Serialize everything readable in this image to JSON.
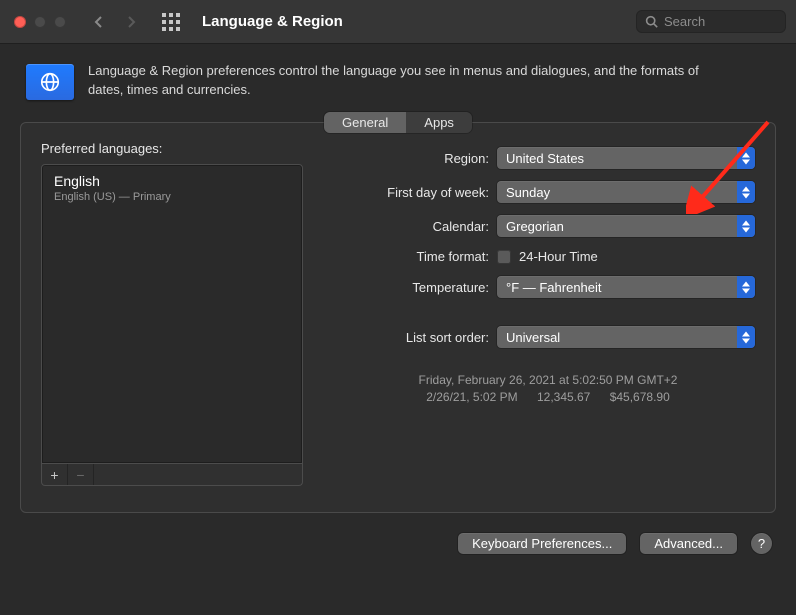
{
  "window": {
    "title": "Language & Region",
    "search_placeholder": "Search"
  },
  "intro": {
    "text": "Language & Region preferences control the language you see in menus and dialogues, and the formats of dates, times and currencies."
  },
  "tabs": {
    "general": "General",
    "apps": "Apps"
  },
  "preferred_languages": {
    "label": "Preferred languages:",
    "items": [
      {
        "name": "English",
        "sub": "English (US) — Primary"
      }
    ]
  },
  "form": {
    "region_label": "Region:",
    "region_value": "United States",
    "first_day_label": "First day of week:",
    "first_day_value": "Sunday",
    "calendar_label": "Calendar:",
    "calendar_value": "Gregorian",
    "time_format_label": "Time format:",
    "time_format_checkbox": "24-Hour Time",
    "temperature_label": "Temperature:",
    "temperature_value": "°F — Fahrenheit",
    "list_sort_label": "List sort order:",
    "list_sort_value": "Universal"
  },
  "sample": {
    "line1": "Friday, February 26, 2021 at 5:02:50 PM GMT+2",
    "line2_a": "2/26/21, 5:02 PM",
    "line2_b": "12,345.67",
    "line2_c": "$45,678.90"
  },
  "buttons": {
    "keyboard": "Keyboard Preferences...",
    "advanced": "Advanced...",
    "help": "?"
  }
}
